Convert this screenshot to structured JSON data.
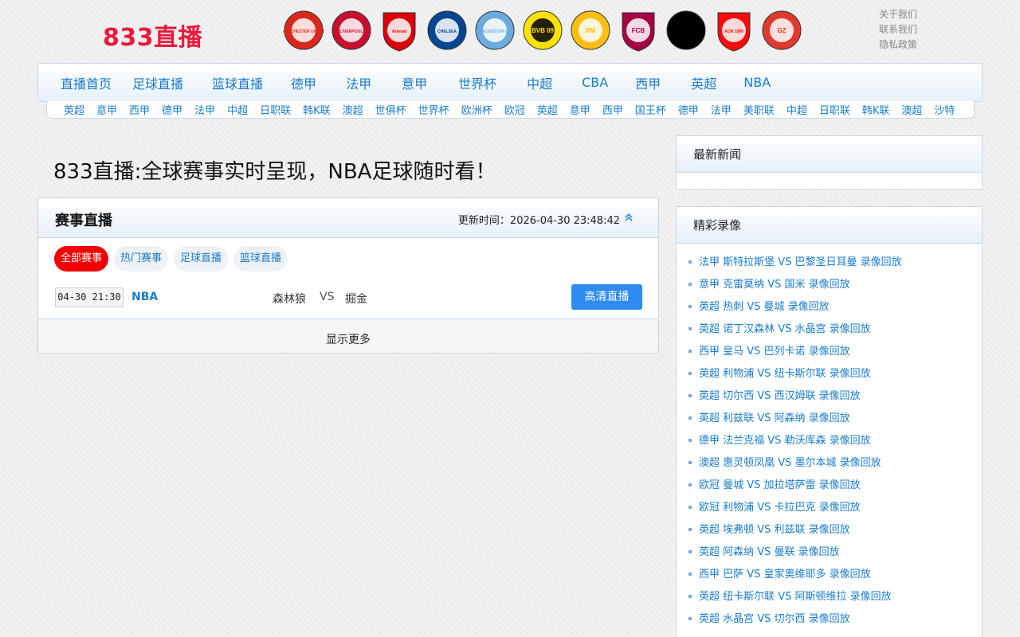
{
  "header": {
    "logo": "833直播",
    "toplinks": [
      "关于我们",
      "联系我们",
      "隐私政策"
    ],
    "badges": [
      {
        "name": "manchester-united-badge",
        "text": "MANCHESTER UNITED",
        "color": "#da291c"
      },
      {
        "name": "liverpool-badge",
        "text": "LIVERPOOL",
        "color": "#c8102e"
      },
      {
        "name": "arsenal-badge",
        "text": "Arsenal",
        "color": "#db0007"
      },
      {
        "name": "chelsea-badge",
        "text": "CHELSEA",
        "color": "#034694"
      },
      {
        "name": "manchester-city-badge",
        "text": "MANCHESTER CITY",
        "color": "#6cabdd"
      },
      {
        "name": "dortmund-badge",
        "text": "BVB 09",
        "color": "#fde100"
      },
      {
        "name": "real-madrid-badge",
        "text": "RM",
        "color": "#febe10"
      },
      {
        "name": "barcelona-badge",
        "text": "FCB",
        "color": "#a50044"
      },
      {
        "name": "juventus-badge",
        "text": "JUVENTUS",
        "color": "#000000"
      },
      {
        "name": "ac-milan-badge",
        "text": "ACM 1899",
        "color": "#fb090b"
      },
      {
        "name": "guangzhou-badge",
        "text": "GZ",
        "color": "#e03a2f"
      }
    ]
  },
  "mainnav": [
    "直播首页",
    "足球直播",
    "篮球直播",
    "德甲",
    "法甲",
    "意甲",
    "世界杯",
    "中超",
    "CBA",
    "西甲",
    "英超",
    "NBA"
  ],
  "subnav": [
    "英超",
    "意甲",
    "西甲",
    "德甲",
    "法甲",
    "中超",
    "日职联",
    "韩K联",
    "澳超",
    "世俱杯",
    "世界杯",
    "欧洲杯",
    "欧冠",
    "英超",
    "意甲",
    "西甲",
    "国王杯",
    "德甲",
    "法甲",
    "美职联",
    "中超",
    "日职联",
    "韩K联",
    "澳超",
    "沙特"
  ],
  "headline": "833直播:全球赛事实时呈现，NBA足球随时看！",
  "live": {
    "title": "赛事直播",
    "update_label": "更新时间：",
    "update_time": "2026-04-30 23:48:42",
    "filters": [
      "全部赛事",
      "热门赛事",
      "足球直播",
      "篮球直播"
    ],
    "match": {
      "time": "04-30 21:30",
      "league": "NBA",
      "home": "森林狼",
      "vs": "VS",
      "away": "掘金",
      "watch": "高清直播"
    },
    "more": "显示更多"
  },
  "sidebar": {
    "news_title": "最新新闻",
    "replay_title": "精彩录像",
    "replays": [
      "法甲 斯特拉斯堡 VS 巴黎圣日耳曼 录像回放",
      "意甲 克雷莫纳 VS 国米 录像回放",
      "英超 热刺 VS 曼城 录像回放",
      "英超 诺丁汉森林 VS 水晶宫 录像回放",
      "西甲 皇马 VS 巴列卡诺 录像回放",
      "英超 利物浦 VS 纽卡斯尔联 录像回放",
      "英超 切尔西 VS 西汉姆联 录像回放",
      "英超 利兹联 VS 阿森纳 录像回放",
      "德甲 法兰克福 VS 勒沃库森 录像回放",
      "澳超 惠灵顿凤凰 VS 墨尔本城 录像回放",
      "欧冠 曼城 VS 加拉塔萨雷 录像回放",
      "欧冠 利物浦 VS 卡拉巴克 录像回放",
      "英超 埃弗顿 VS 利兹联 录像回放",
      "英超 阿森纳 VS 曼联 录像回放",
      "西甲 巴萨 VS 皇家奥维耶多 录像回放",
      "英超 纽卡斯尔联 VS 阿斯顿维拉 录像回放",
      "英超 水晶宫 VS 切尔西 录像回放"
    ]
  }
}
